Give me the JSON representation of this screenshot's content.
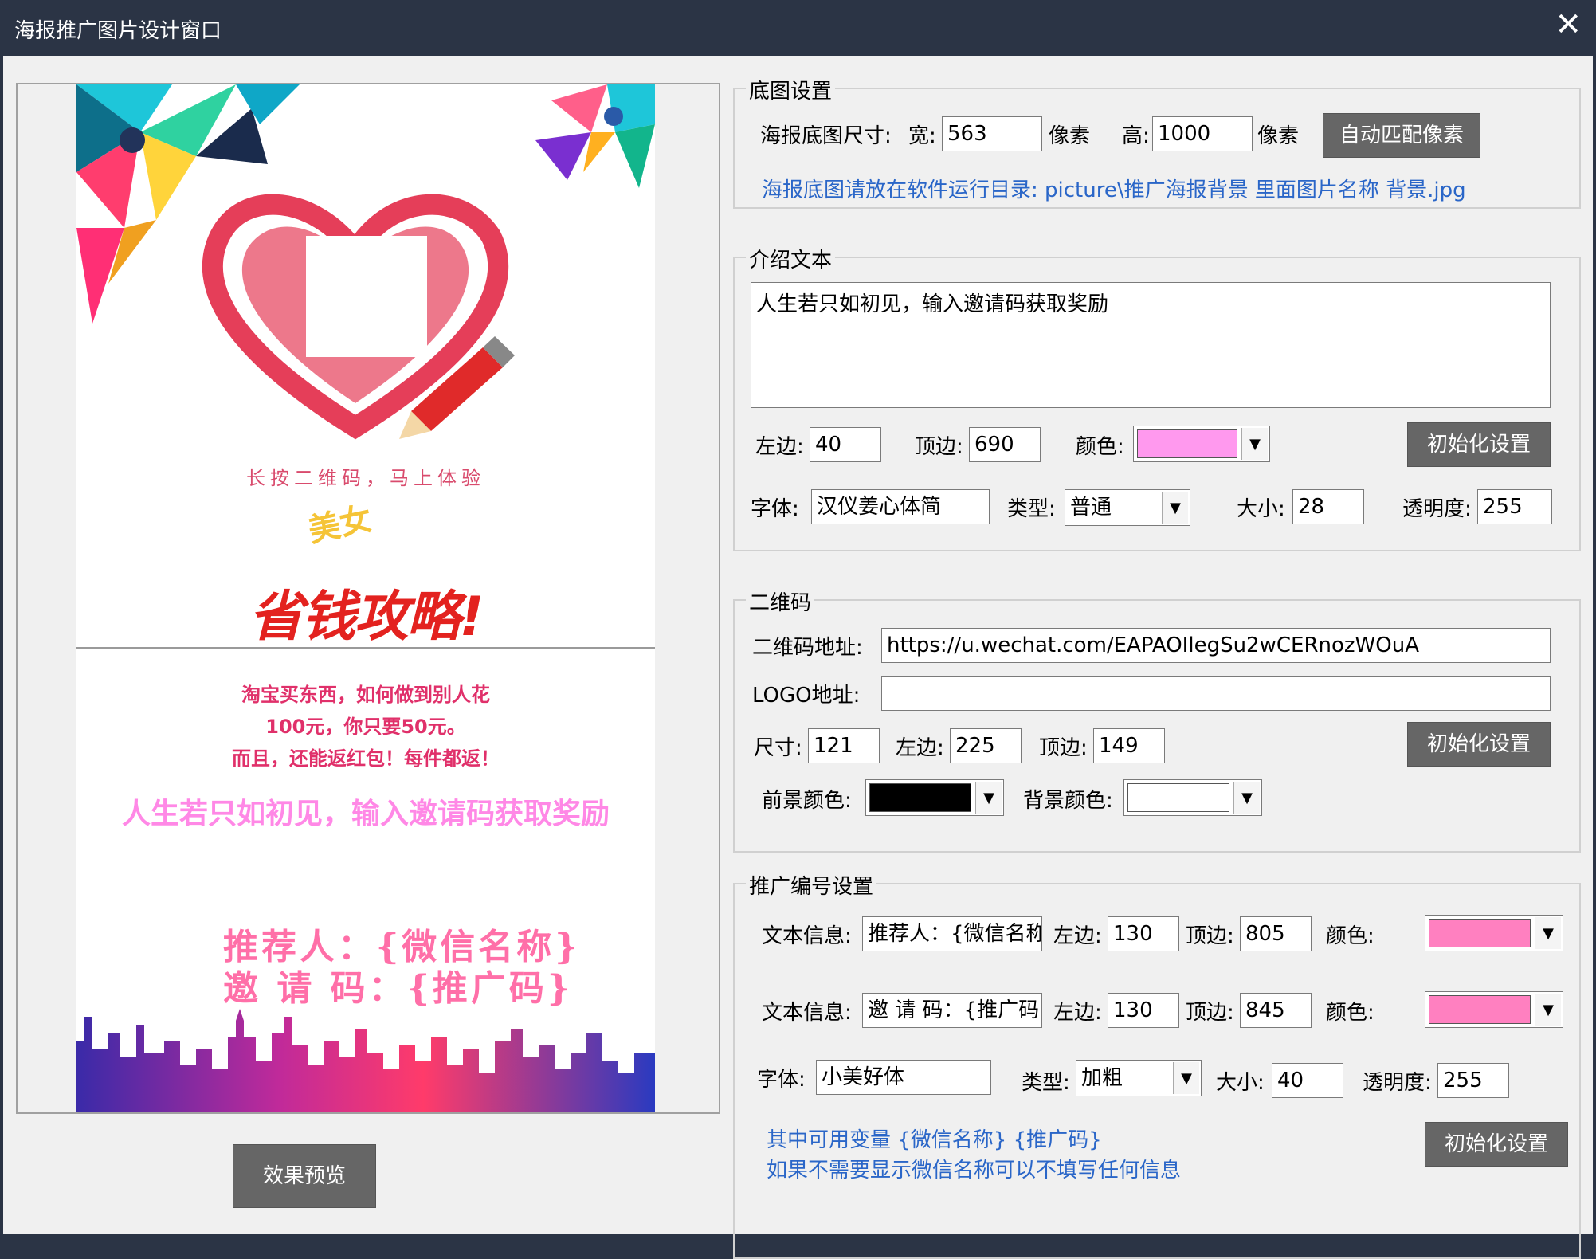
{
  "window": {
    "title": "海报推广图片设计窗口",
    "close_glyph": "✕"
  },
  "poster": {
    "tagline": "长按二维码，马上体验",
    "slogan_small": "美女",
    "slogan_big": "省钱攻略!",
    "desc_lines": [
      "淘宝买东西，如何做到别人花",
      "100元，你只要50元。",
      "而且，还能返红包！每件都返！"
    ],
    "intro_text": "人生若只如初见，输入邀请码获取奖励",
    "promo_line1": "推荐人：{微信名称}",
    "promo_line2": "邀 请 码：{推广码}"
  },
  "preview_button": "效果预览",
  "background_group": {
    "title": "底图设置",
    "size_label": "海报底图尺寸:",
    "width_label": "宽:",
    "width_value": "563",
    "unit1": "像素",
    "height_label": "高:",
    "height_value": "1000",
    "unit2": "像素",
    "auto_button": "自动匹配像素",
    "hint": "海报底图请放在软件运行目录: picture\\推广海报背景 里面图片名称 背景.jpg"
  },
  "intro_group": {
    "title": "介绍文本",
    "text_value": "人生若只如初见，输入邀请码获取奖励",
    "left_label": "左边:",
    "left_value": "40",
    "top_label": "顶边:",
    "top_value": "690",
    "color_label": "颜色:",
    "color_value": "#ff99ee",
    "reset_button": "初始化设置",
    "font_label": "字体:",
    "font_value": "汉仪姜心体简",
    "type_label": "类型:",
    "type_value": "普通",
    "size_label": "大小:",
    "size_value": "28",
    "alpha_label": "透明度:",
    "alpha_value": "255"
  },
  "qr_group": {
    "title": "二维码",
    "url_label": "二维码地址:",
    "url_value": "https://u.wechat.com/EAPAOIlegSu2wCERnozWOuA",
    "logo_label": "LOGO地址:",
    "logo_value": "",
    "size_label": "尺寸:",
    "size_value": "121",
    "left_label": "左边:",
    "left_value": "225",
    "top_label": "顶边:",
    "top_value": "149",
    "reset_button": "初始化设置",
    "fg_label": "前景颜色:",
    "fg_color": "#000000",
    "bg_label": "背景颜色:",
    "bg_color": "#ffffff"
  },
  "promo_group": {
    "title": "推广编号设置",
    "row1": {
      "label": "文本信息:",
      "value": "推荐人：{微信名称}",
      "left_label": "左边:",
      "left_value": "130",
      "top_label": "顶边:",
      "top_value": "805",
      "color_label": "颜色:",
      "color": "#ff80c0"
    },
    "row2": {
      "label": "文本信息:",
      "value": "邀 请 码：{推广码}",
      "left_label": "左边:",
      "left_value": "130",
      "top_label": "顶边:",
      "top_value": "845",
      "color_label": "颜色:",
      "color": "#ff80c0"
    },
    "font_label": "字体:",
    "font_value": "小美好体",
    "type_label": "类型:",
    "type_value": "加粗",
    "size_label": "大小:",
    "size_value": "40",
    "alpha_label": "透明度:",
    "alpha_value": "255",
    "hint1": "其中可用变量 {微信名称} {推广码}",
    "hint2": "如果不需要显示微信名称可以不填写任何信息",
    "reset_button": "初始化设置"
  },
  "icons": {
    "dropdown": "chevron-down-icon",
    "close": "close-icon"
  }
}
